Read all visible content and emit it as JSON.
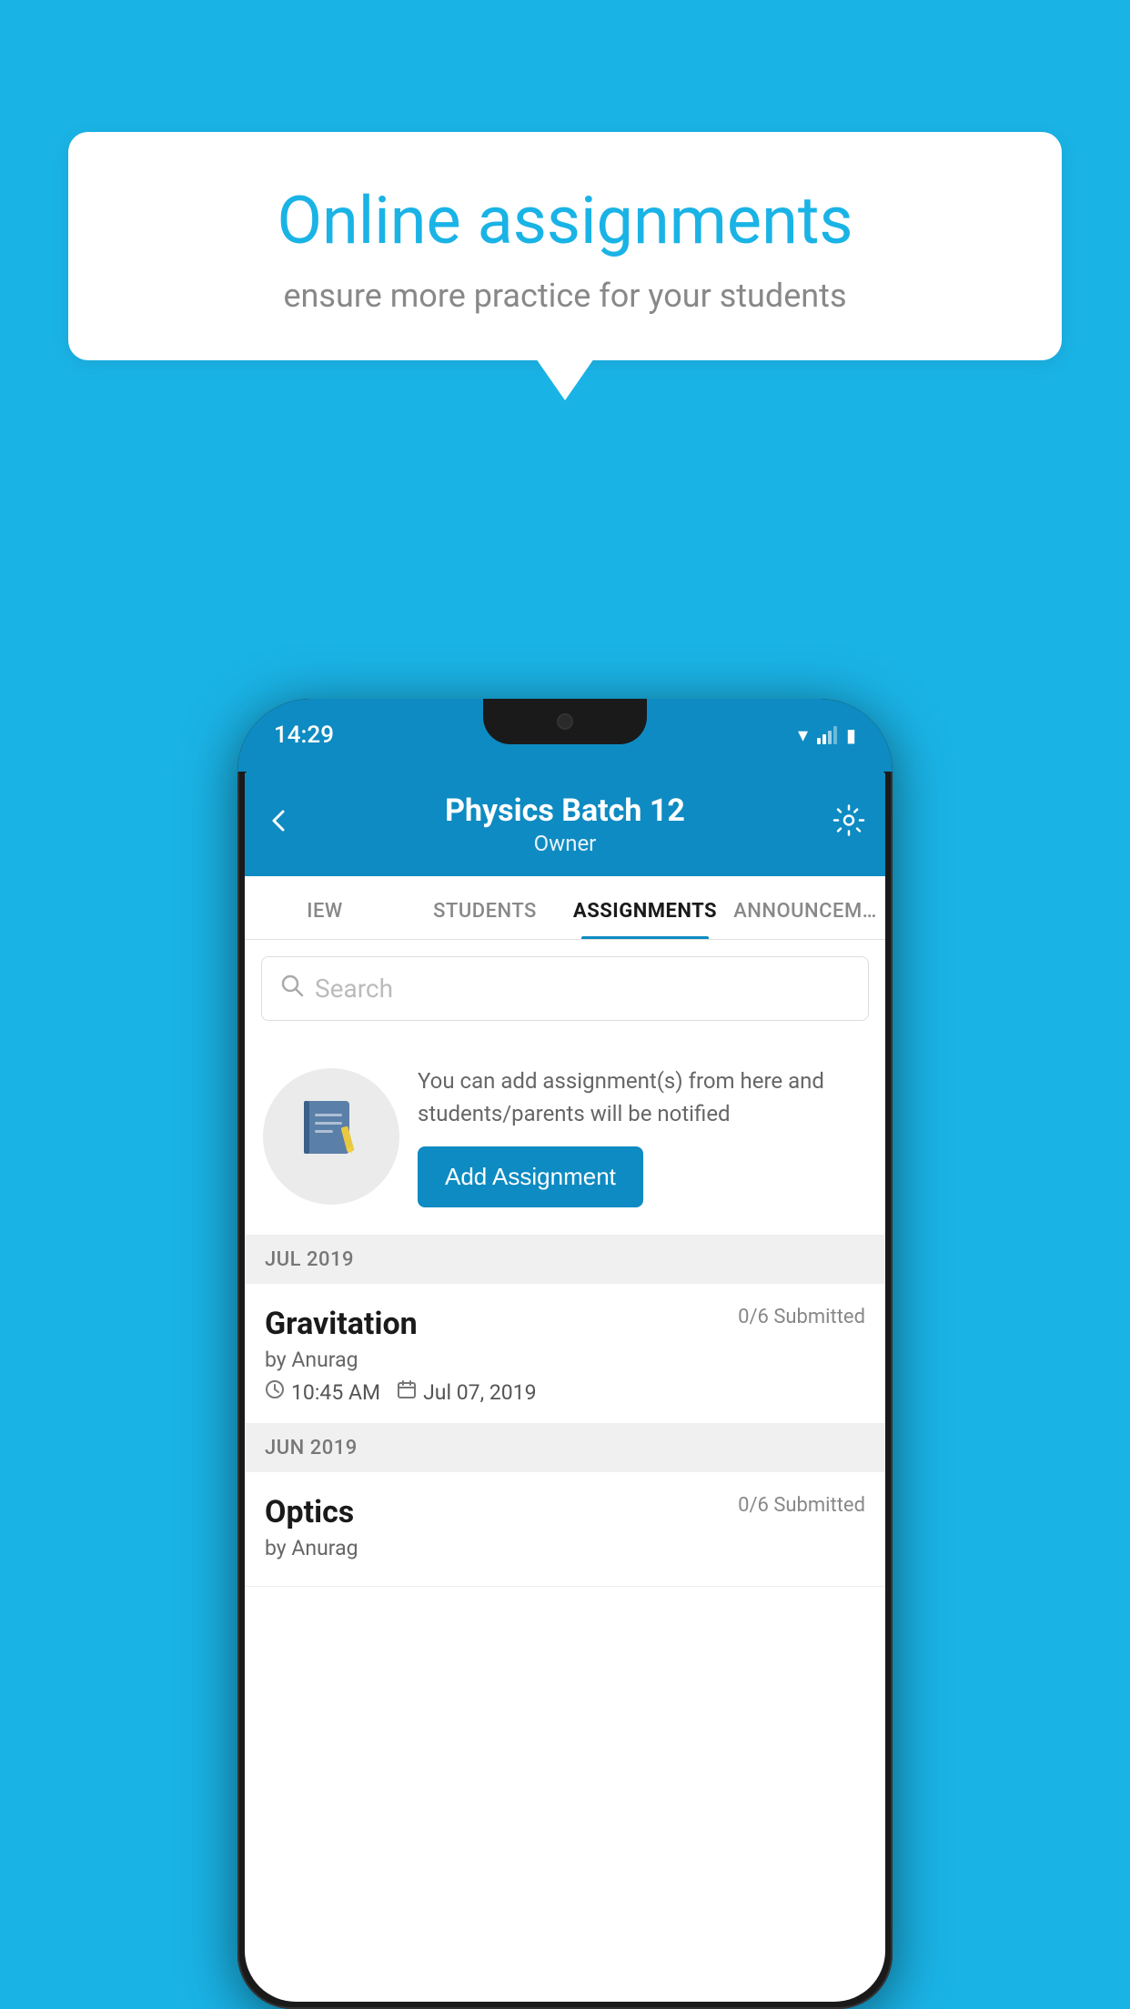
{
  "background": {
    "color": "#1ab3e6"
  },
  "speech_bubble": {
    "title": "Online assignments",
    "subtitle": "ensure more practice for your students"
  },
  "status_bar": {
    "time": "14:29",
    "icons": [
      "wifi",
      "signal",
      "battery"
    ]
  },
  "app_header": {
    "title": "Physics Batch 12",
    "subtitle": "Owner",
    "back_label": "←",
    "settings_label": "⚙"
  },
  "tabs": [
    {
      "label": "IEW",
      "active": false
    },
    {
      "label": "STUDENTS",
      "active": false
    },
    {
      "label": "ASSIGNMENTS",
      "active": true
    },
    {
      "label": "ANNOUNCEM…",
      "active": false
    }
  ],
  "search": {
    "placeholder": "Search"
  },
  "intro_card": {
    "description": "You can add assignment(s) from here and students/parents will be notified",
    "button_label": "Add Assignment"
  },
  "sections": [
    {
      "month": "JUL 2019",
      "assignments": [
        {
          "name": "Gravitation",
          "submitted": "0/6 Submitted",
          "by": "by Anurag",
          "time": "10:45 AM",
          "date": "Jul 07, 2019"
        }
      ]
    },
    {
      "month": "JUN 2019",
      "assignments": [
        {
          "name": "Optics",
          "submitted": "0/6 Submitted",
          "by": "by Anurag",
          "time": "",
          "date": ""
        }
      ]
    }
  ]
}
